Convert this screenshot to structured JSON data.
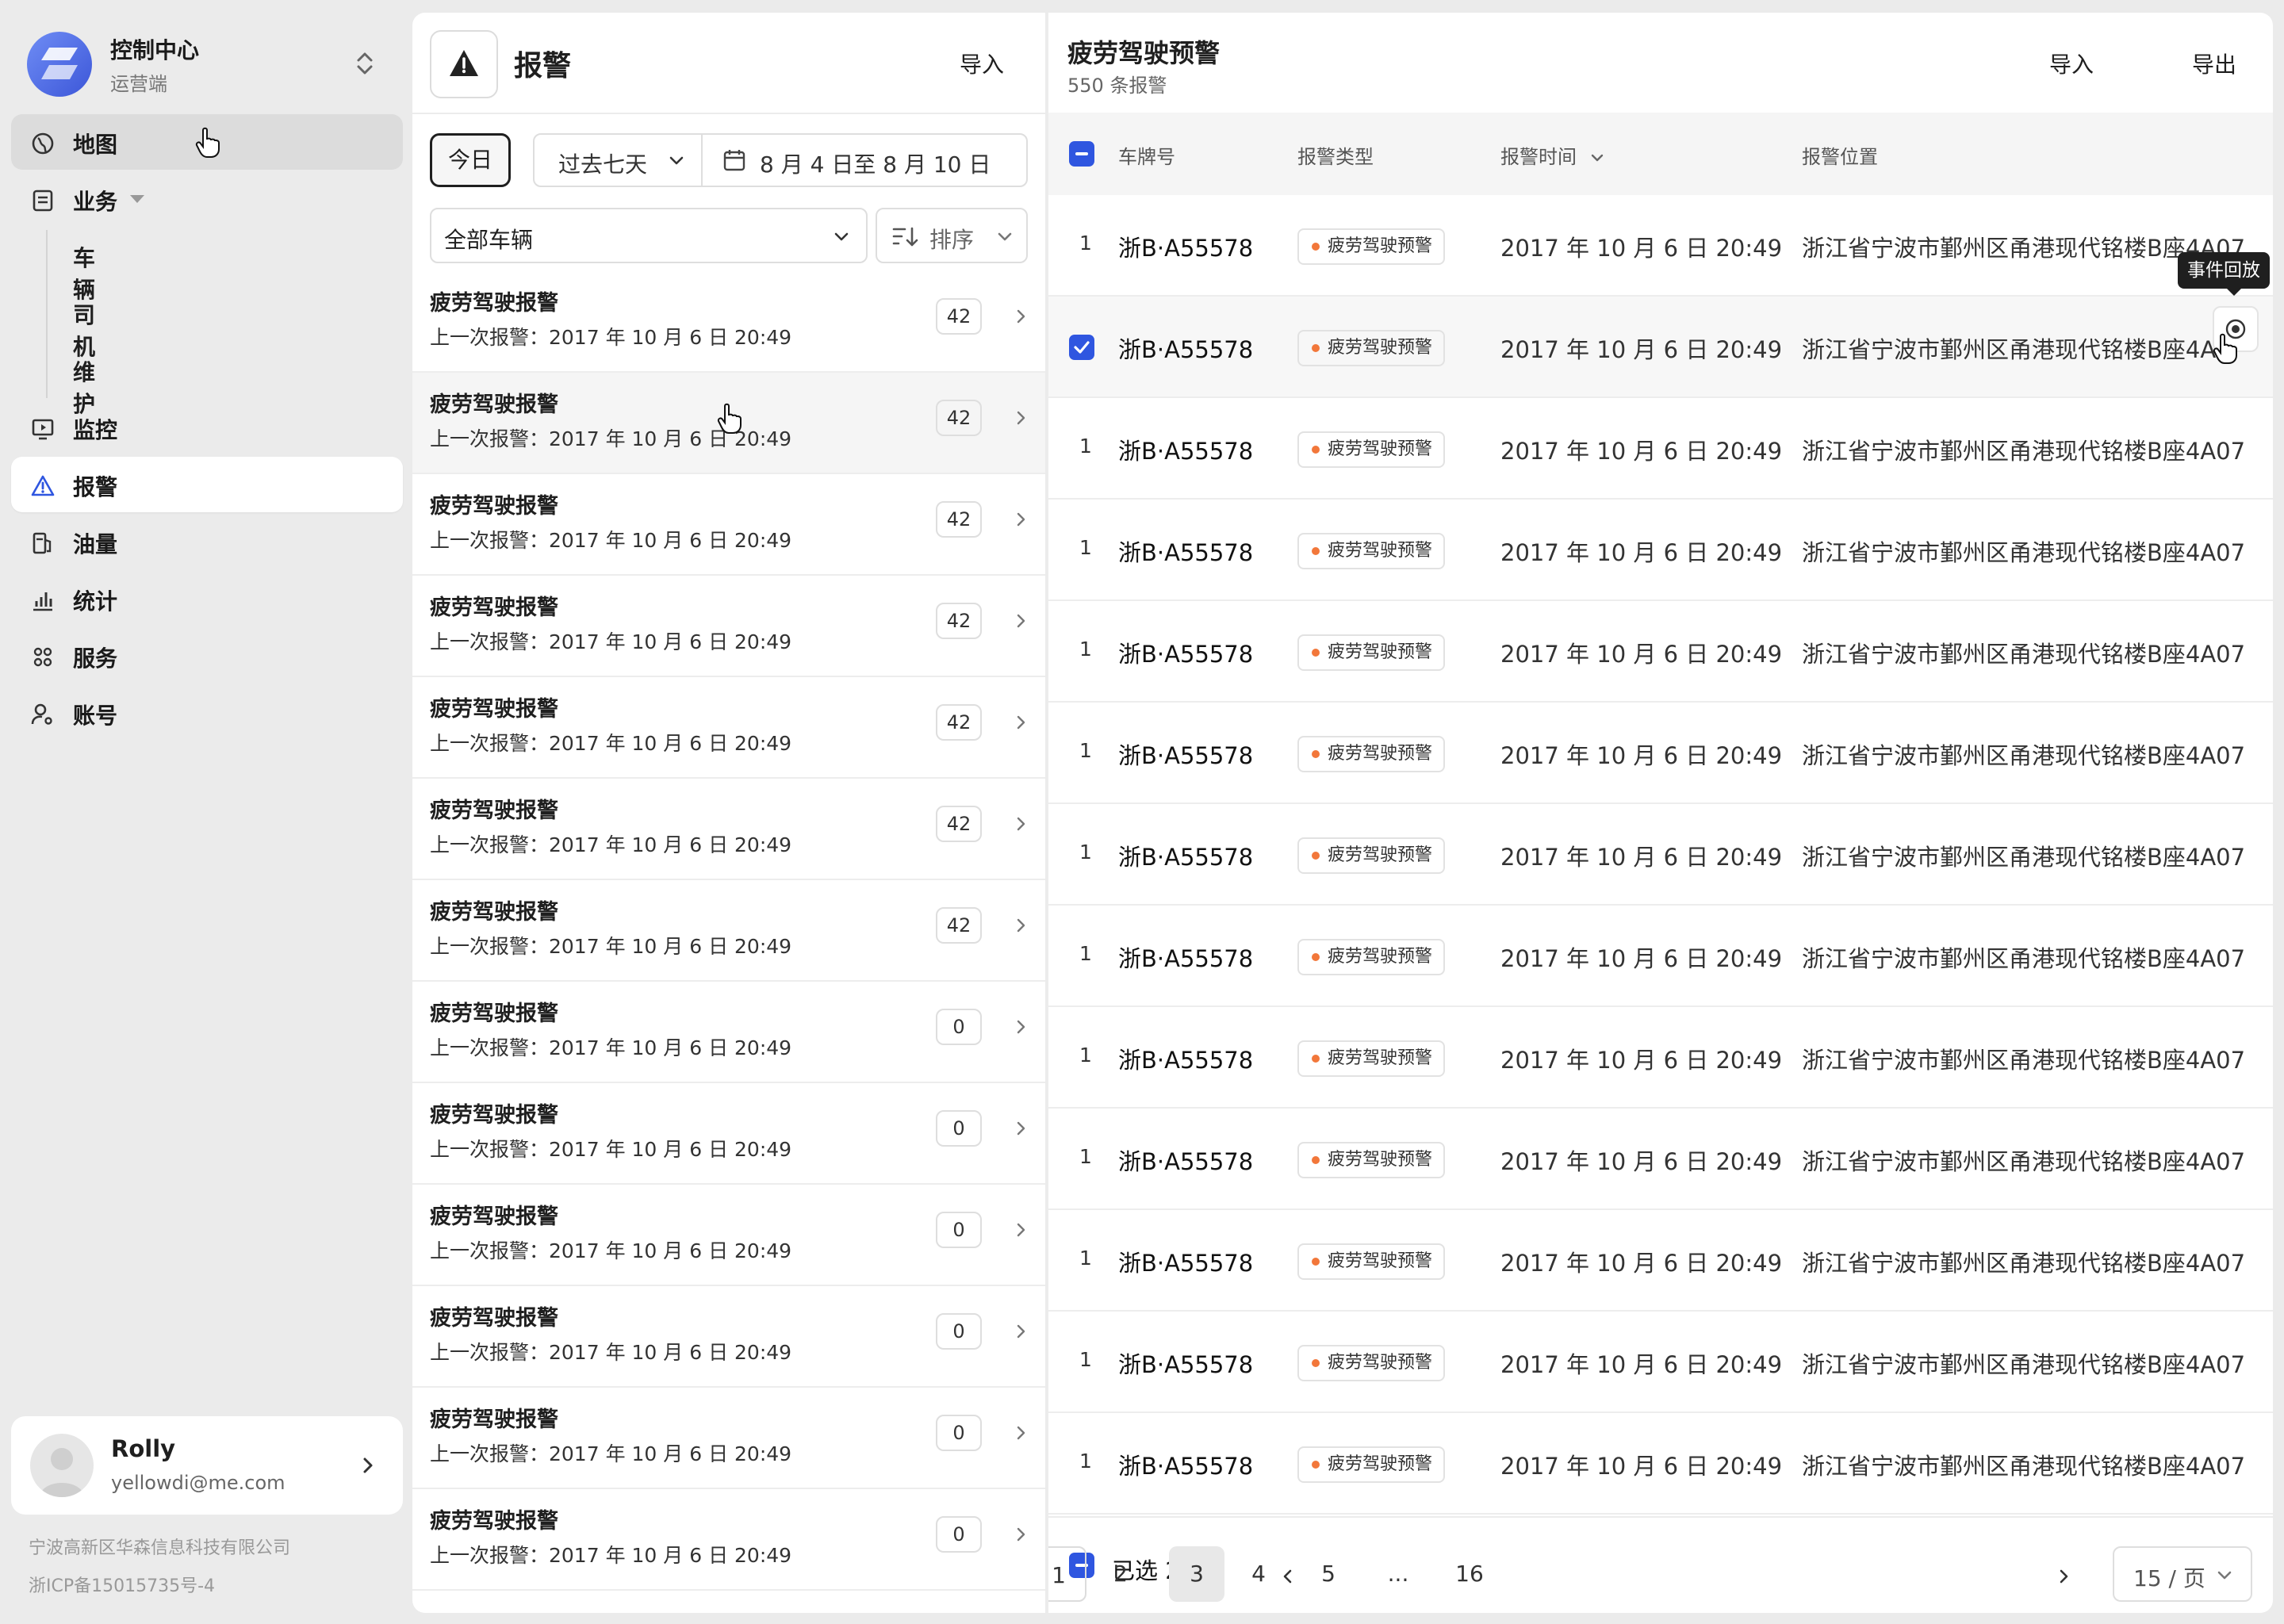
{
  "brand": {
    "title": "控制中心",
    "subtitle": "运营端"
  },
  "nav": {
    "map": "地图",
    "business": "业务",
    "vehicles": "车辆",
    "drivers": "司机",
    "maintenance": "维护",
    "monitor": "监控",
    "alarm": "报警",
    "fuel": "油量",
    "stats": "统计",
    "service": "服务",
    "account": "账号"
  },
  "user": {
    "name": "Rolly",
    "email": "yellowdi@me.com"
  },
  "footer": {
    "company": "宁波高新区华森信息科技有限公司",
    "icp": "浙ICP备15015735号-4"
  },
  "middle": {
    "title": "报警",
    "import_label": "导入",
    "today_label": "今日",
    "range_label": "过去七天",
    "date_range": "8 月 4 日至 8 月 10 日",
    "vehicle_filter": "全部车辆",
    "sort_label": "排序",
    "alarms": [
      {
        "title": "疲劳驾驶报警",
        "last": "上一次报警：2017 年 10 月 6 日 20:49",
        "count": "42"
      },
      {
        "title": "疲劳驾驶报警",
        "last": "上一次报警：2017 年 10 月 6 日 20:49",
        "count": "42"
      },
      {
        "title": "疲劳驾驶报警",
        "last": "上一次报警：2017 年 10 月 6 日 20:49",
        "count": "42"
      },
      {
        "title": "疲劳驾驶报警",
        "last": "上一次报警：2017 年 10 月 6 日 20:49",
        "count": "42"
      },
      {
        "title": "疲劳驾驶报警",
        "last": "上一次报警：2017 年 10 月 6 日 20:49",
        "count": "42"
      },
      {
        "title": "疲劳驾驶报警",
        "last": "上一次报警：2017 年 10 月 6 日 20:49",
        "count": "42"
      },
      {
        "title": "疲劳驾驶报警",
        "last": "上一次报警：2017 年 10 月 6 日 20:49",
        "count": "42"
      },
      {
        "title": "疲劳驾驶报警",
        "last": "上一次报警：2017 年 10 月 6 日 20:49",
        "count": "0"
      },
      {
        "title": "疲劳驾驶报警",
        "last": "上一次报警：2017 年 10 月 6 日 20:49",
        "count": "0"
      },
      {
        "title": "疲劳驾驶报警",
        "last": "上一次报警：2017 年 10 月 6 日 20:49",
        "count": "0"
      },
      {
        "title": "疲劳驾驶报警",
        "last": "上一次报警：2017 年 10 月 6 日 20:49",
        "count": "0"
      },
      {
        "title": "疲劳驾驶报警",
        "last": "上一次报警：2017 年 10 月 6 日 20:49",
        "count": "0"
      },
      {
        "title": "疲劳驾驶报警",
        "last": "上一次报警：2017 年 10 月 6 日 20:49",
        "count": "0"
      }
    ]
  },
  "right": {
    "title": "疲劳驾驶预警",
    "count_label": "550 条报警",
    "import_label": "导入",
    "export_label": "导出",
    "columns": {
      "plate": "车牌号",
      "type": "报警类型",
      "time": "报警时间",
      "location": "报警位置"
    },
    "tooltip": "事件回放",
    "rows": [
      {
        "index": "1",
        "checked": false,
        "plate": "浙B·A55578",
        "type": "疲劳驾驶预警",
        "time": "2017 年 10 月 6 日 20:49",
        "location": "浙江省宁波市鄞州区甬港现代铭楼B座4A07"
      },
      {
        "index": "",
        "checked": true,
        "plate": "浙B·A55578",
        "type": "疲劳驾驶预警",
        "time": "2017 年 10 月 6 日 20:49",
        "location": "浙江省宁波市鄞州区甬港现代铭楼B座4A"
      },
      {
        "index": "1",
        "checked": false,
        "plate": "浙B·A55578",
        "type": "疲劳驾驶预警",
        "time": "2017 年 10 月 6 日 20:49",
        "location": "浙江省宁波市鄞州区甬港现代铭楼B座4A07"
      },
      {
        "index": "1",
        "checked": false,
        "plate": "浙B·A55578",
        "type": "疲劳驾驶预警",
        "time": "2017 年 10 月 6 日 20:49",
        "location": "浙江省宁波市鄞州区甬港现代铭楼B座4A07"
      },
      {
        "index": "1",
        "checked": false,
        "plate": "浙B·A55578",
        "type": "疲劳驾驶预警",
        "time": "2017 年 10 月 6 日 20:49",
        "location": "浙江省宁波市鄞州区甬港现代铭楼B座4A07"
      },
      {
        "index": "1",
        "checked": false,
        "plate": "浙B·A55578",
        "type": "疲劳驾驶预警",
        "time": "2017 年 10 月 6 日 20:49",
        "location": "浙江省宁波市鄞州区甬港现代铭楼B座4A07"
      },
      {
        "index": "1",
        "checked": false,
        "plate": "浙B·A55578",
        "type": "疲劳驾驶预警",
        "time": "2017 年 10 月 6 日 20:49",
        "location": "浙江省宁波市鄞州区甬港现代铭楼B座4A07"
      },
      {
        "index": "1",
        "checked": false,
        "plate": "浙B·A55578",
        "type": "疲劳驾驶预警",
        "time": "2017 年 10 月 6 日 20:49",
        "location": "浙江省宁波市鄞州区甬港现代铭楼B座4A07"
      },
      {
        "index": "1",
        "checked": false,
        "plate": "浙B·A55578",
        "type": "疲劳驾驶预警",
        "time": "2017 年 10 月 6 日 20:49",
        "location": "浙江省宁波市鄞州区甬港现代铭楼B座4A07"
      },
      {
        "index": "1",
        "checked": false,
        "plate": "浙B·A55578",
        "type": "疲劳驾驶预警",
        "time": "2017 年 10 月 6 日 20:49",
        "location": "浙江省宁波市鄞州区甬港现代铭楼B座4A07"
      },
      {
        "index": "1",
        "checked": false,
        "plate": "浙B·A55578",
        "type": "疲劳驾驶预警",
        "time": "2017 年 10 月 6 日 20:49",
        "location": "浙江省宁波市鄞州区甬港现代铭楼B座4A07"
      },
      {
        "index": "1",
        "checked": false,
        "plate": "浙B·A55578",
        "type": "疲劳驾驶预警",
        "time": "2017 年 10 月 6 日 20:49",
        "location": "浙江省宁波市鄞州区甬港现代铭楼B座4A07"
      },
      {
        "index": "1",
        "checked": false,
        "plate": "浙B·A55578",
        "type": "疲劳驾驶预警",
        "time": "2017 年 10 月 6 日 20:49",
        "location": "浙江省宁波市鄞州区甬港现代铭楼B座4A07"
      }
    ],
    "footer": {
      "selected_label": "已选 2 项",
      "pages": [
        "1",
        "2",
        "3",
        "4",
        "5",
        "...",
        "16"
      ],
      "current_page": "1",
      "highlighted_page": "3",
      "page_size": "15 / 页"
    }
  },
  "colors": {
    "accent": "#2f56e0",
    "tag_dot": "#f2773a"
  }
}
